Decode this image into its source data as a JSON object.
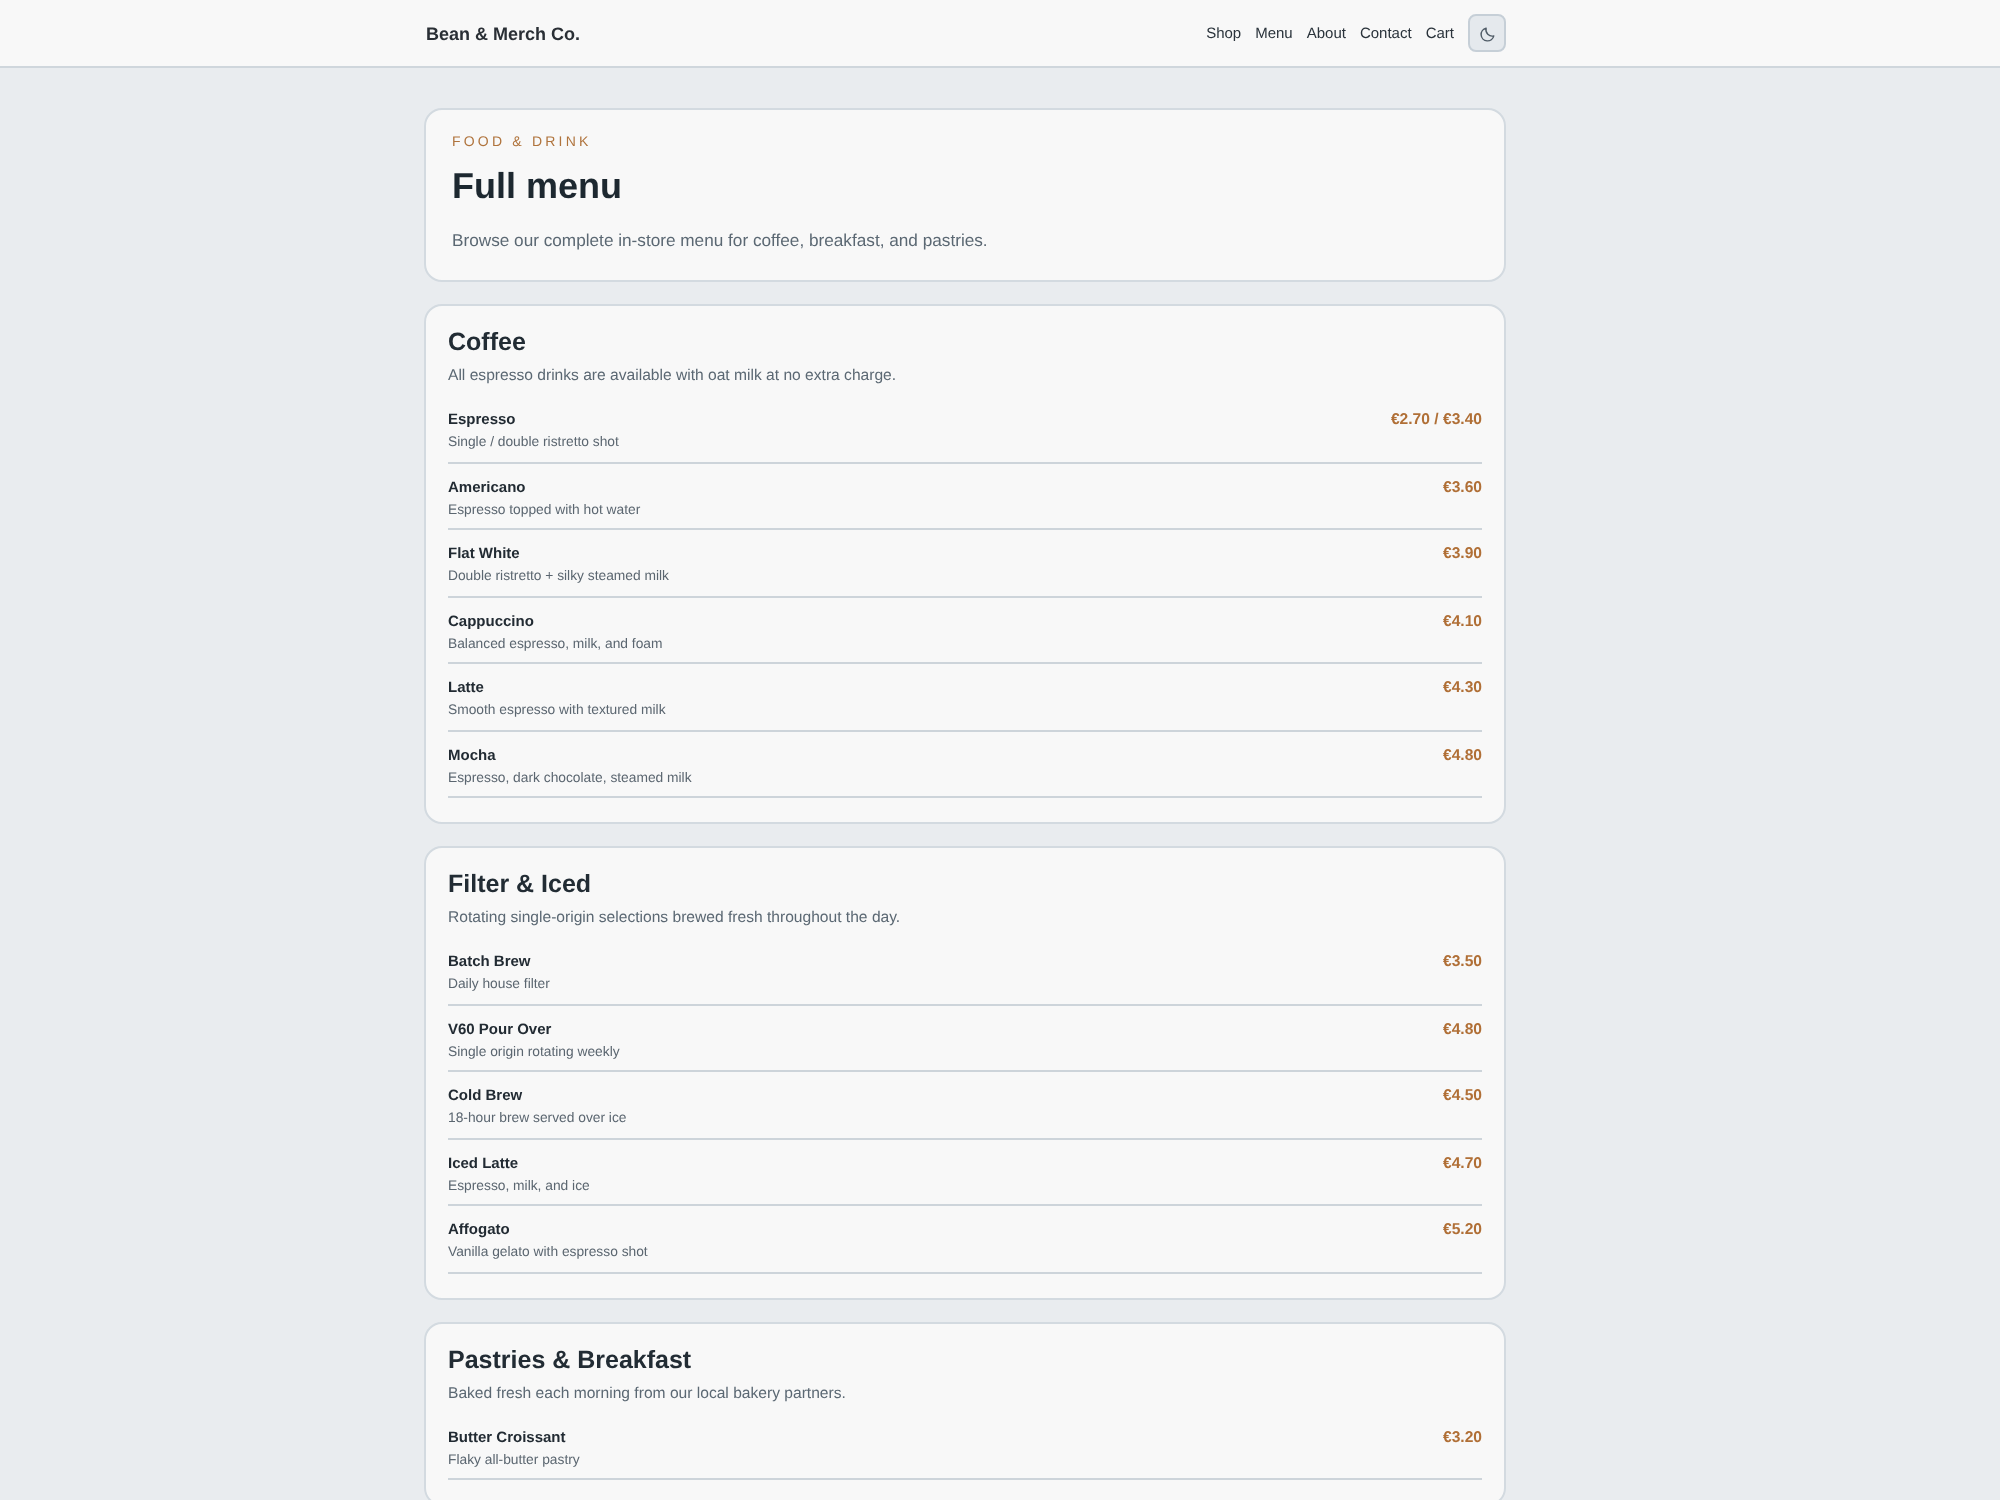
{
  "header": {
    "brand": "Bean & Merch Co.",
    "nav": [
      "Shop",
      "Menu",
      "About",
      "Contact",
      "Cart"
    ]
  },
  "hero": {
    "eyebrow": "FOOD & DRINK",
    "title": "Full menu",
    "subtitle": "Browse our complete in-store menu for coffee, breakfast, and pastries."
  },
  "sections": [
    {
      "title": "Coffee",
      "note": "All espresso drinks are available with oat milk at no extra charge.",
      "items": [
        {
          "name": "Espresso",
          "description": "Single / double ristretto shot",
          "price": "€2.70 / €3.40"
        },
        {
          "name": "Americano",
          "description": "Espresso topped with hot water",
          "price": "€3.60"
        },
        {
          "name": "Flat White",
          "description": "Double ristretto + silky steamed milk",
          "price": "€3.90"
        },
        {
          "name": "Cappuccino",
          "description": "Balanced espresso, milk, and foam",
          "price": "€4.10"
        },
        {
          "name": "Latte",
          "description": "Smooth espresso with textured milk",
          "price": "€4.30"
        },
        {
          "name": "Mocha",
          "description": "Espresso, dark chocolate, steamed milk",
          "price": "€4.80"
        }
      ]
    },
    {
      "title": "Filter & Iced",
      "note": "Rotating single-origin selections brewed fresh throughout the day.",
      "items": [
        {
          "name": "Batch Brew",
          "description": "Daily house filter",
          "price": "€3.50"
        },
        {
          "name": "V60 Pour Over",
          "description": "Single origin rotating weekly",
          "price": "€4.80"
        },
        {
          "name": "Cold Brew",
          "description": "18-hour brew served over ice",
          "price": "€4.50"
        },
        {
          "name": "Iced Latte",
          "description": "Espresso, milk, and ice",
          "price": "€4.70"
        },
        {
          "name": "Affogato",
          "description": "Vanilla gelato with espresso shot",
          "price": "€5.20"
        }
      ]
    },
    {
      "title": "Pastries & Breakfast",
      "note": "Baked fresh each morning from our local bakery partners.",
      "items": [
        {
          "name": "Butter Croissant",
          "description": "Flaky all-butter pastry",
          "price": "€3.20"
        }
      ]
    }
  ]
}
